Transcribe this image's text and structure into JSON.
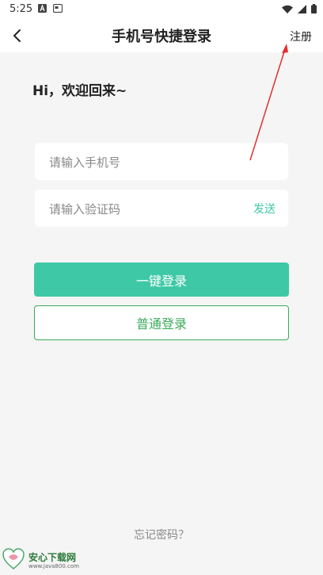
{
  "status_bar": {
    "time": "5:25",
    "left_icons": [
      "a-notification-icon",
      "screen-notification-icon"
    ],
    "right_icons": [
      "wifi-icon",
      "signal-icon",
      "battery-icon"
    ]
  },
  "header": {
    "title": "手机号快捷登录",
    "register_label": "注册"
  },
  "greeting": "Hi，欢迎回来~",
  "form": {
    "phone_placeholder": "请输入手机号",
    "phone_value": "",
    "code_placeholder": "请输入验证码",
    "code_value": "",
    "send_label": "发送"
  },
  "buttons": {
    "quick_login_label": "一键登录",
    "normal_login_label": "普通登录"
  },
  "forgot_password_label": "忘记密码？",
  "watermark": {
    "name": "安心下载网",
    "url": "www.java800.com"
  },
  "colors": {
    "accent": "#3ec8a6",
    "secondary": "#3aab5a",
    "annotation": "#e03030",
    "background": "#f5f5f5"
  }
}
